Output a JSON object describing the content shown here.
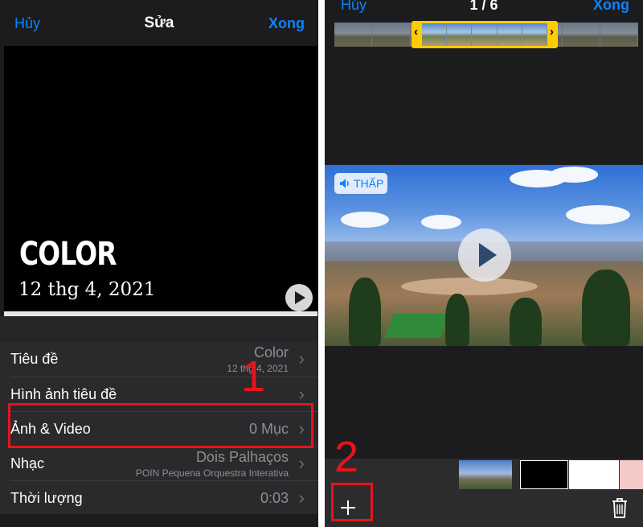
{
  "left": {
    "nav": {
      "cancel": "Hủy",
      "title": "Sửa",
      "done": "Xong"
    },
    "preview": {
      "title": "COLOR",
      "date": "12 thg 4, 2021"
    },
    "rows": [
      {
        "label": "Tiêu đề",
        "value": "Color",
        "sub": "12 thg 4, 2021"
      },
      {
        "label": "Hình ảnh tiêu đề",
        "value": "",
        "sub": ""
      },
      {
        "label": "Ảnh & Video",
        "value": "0 Mục",
        "sub": ""
      },
      {
        "label": "Nhạc",
        "value": "Dois Palhaços",
        "sub": "POIN Pequena Orquestra Interativa"
      },
      {
        "label": "Thời lượng",
        "value": "0:03",
        "sub": ""
      }
    ]
  },
  "right": {
    "nav": {
      "cancel": "Hủy",
      "count": "1 / 6",
      "done": "Xong"
    },
    "sound_badge": "THẤP"
  },
  "annotations": {
    "step1": "1",
    "step2": "2"
  },
  "colors": {
    "accent": "#0a84ff",
    "highlight": "#e8131b",
    "trim": "#ffcc00"
  },
  "icons": [
    "play-icon",
    "chevron-right-icon",
    "speaker-icon",
    "plus-icon",
    "trash-icon"
  ]
}
